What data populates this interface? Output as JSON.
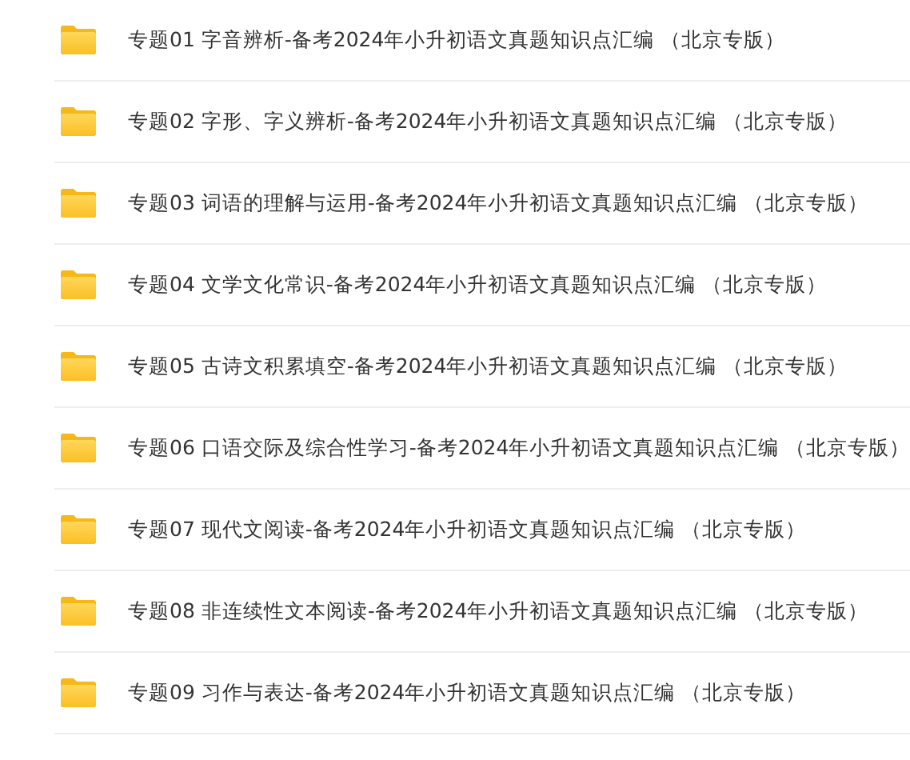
{
  "folders": [
    {
      "name": "专题01 字音辨析-备考2024年小升初语文真题知识点汇编 （北京专版）"
    },
    {
      "name": "专题02 字形、字义辨析-备考2024年小升初语文真题知识点汇编 （北京专版）"
    },
    {
      "name": "专题03 词语的理解与运用-备考2024年小升初语文真题知识点汇编 （北京专版）"
    },
    {
      "name": "专题04 文学文化常识-备考2024年小升初语文真题知识点汇编 （北京专版）"
    },
    {
      "name": "专题05 古诗文积累填空-备考2024年小升初语文真题知识点汇编 （北京专版）"
    },
    {
      "name": "专题06 口语交际及综合性学习-备考2024年小升初语文真题知识点汇编 （北京专版）"
    },
    {
      "name": "专题07 现代文阅读-备考2024年小升初语文真题知识点汇编 （北京专版）"
    },
    {
      "name": "专题08 非连续性文本阅读-备考2024年小升初语文真题知识点汇编 （北京专版）"
    },
    {
      "name": "专题09 习作与表达-备考2024年小升初语文真题知识点汇编 （北京专版）"
    }
  ]
}
